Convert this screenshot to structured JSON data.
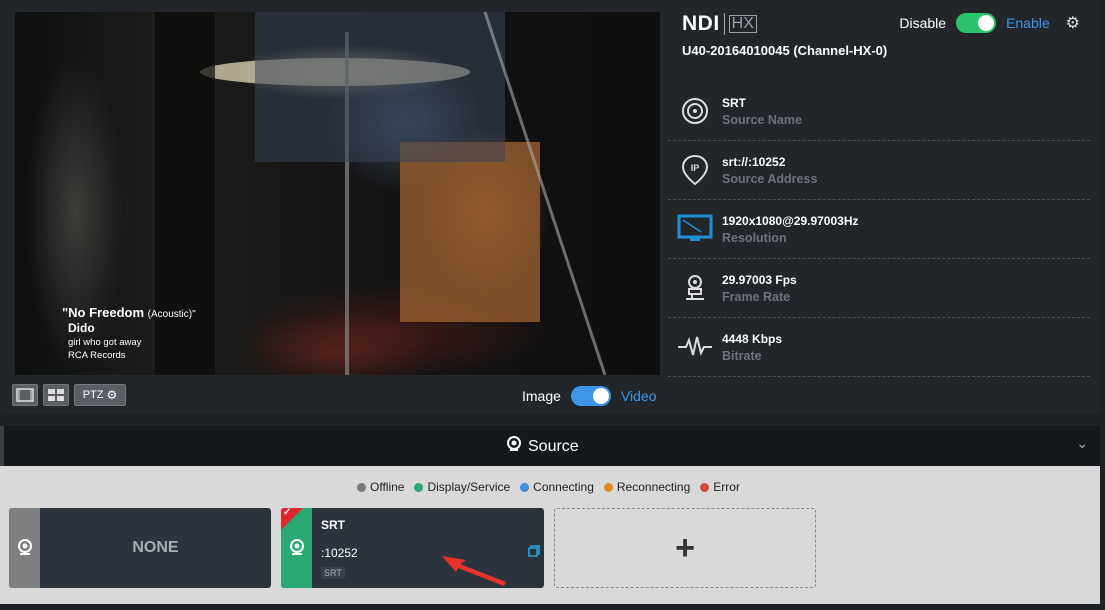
{
  "video": {
    "song_title": "\"No Freedom",
    "song_subtitle": "(Acoustic)\"",
    "artist": "Dido",
    "album": "girl who got away",
    "label": "RCA Records"
  },
  "video_tools": {
    "ptz_label": "PTZ"
  },
  "mode_toggle": {
    "left": "Image",
    "right": "Video",
    "on_color": "#3d96e8"
  },
  "header": {
    "logo_ndi": "NDI",
    "logo_hx": "HX",
    "device": "U40-20164010045 (Channel-HX-0)",
    "enable_left": "Disable",
    "enable_right": "Enable",
    "switch_color": "#2bc36b"
  },
  "info_rows": [
    {
      "value": "SRT",
      "key": "Source Name",
      "icon": "target-icon"
    },
    {
      "value": "srt://:10252",
      "key": "Source Address",
      "icon": "ip-pin-icon"
    },
    {
      "value": "1920x1080@29.97003Hz",
      "key": "Resolution",
      "icon": "monitor-icon"
    },
    {
      "value": "29.97003 Fps",
      "key": "Frame Rate",
      "icon": "frame-rate-icon"
    },
    {
      "value": "4448 Kbps",
      "key": "Bitrate",
      "icon": "pulse-icon"
    }
  ],
  "source_bar": {
    "title": "Source"
  },
  "legend": [
    {
      "label": "Offline",
      "color": "#7a7a7a"
    },
    {
      "label": "Display/Service",
      "color": "#2aa873"
    },
    {
      "label": "Connecting",
      "color": "#3d8fe0"
    },
    {
      "label": "Reconnecting",
      "color": "#e08a1e"
    },
    {
      "label": "Error",
      "color": "#d9453f"
    }
  ],
  "cards": {
    "none_label": "NONE",
    "srt": {
      "name": "SRT",
      "addr": ":10252",
      "proto": "SRT"
    },
    "add_label": "+"
  }
}
